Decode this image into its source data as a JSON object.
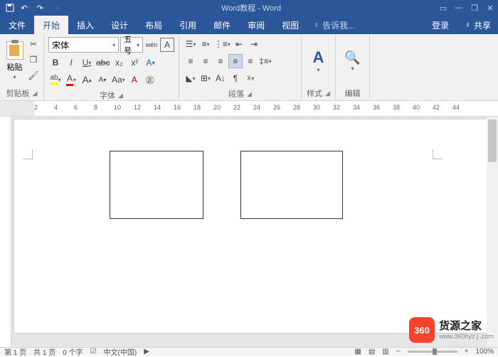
{
  "titlebar": {
    "title": "Word教程 - Word"
  },
  "tabs": {
    "file": "文件",
    "home": "开始",
    "insert": "插入",
    "design": "设计",
    "layout": "布局",
    "references": "引用",
    "mailings": "邮件",
    "review": "审阅",
    "view": "视图"
  },
  "tellme": {
    "placeholder": "告诉我..."
  },
  "account": {
    "signin": "登录",
    "share": "共享"
  },
  "ribbon": {
    "clipboard": {
      "paste": "粘贴",
      "label": "剪贴板"
    },
    "font": {
      "name": "宋体",
      "size": "五号",
      "ruby": "wén",
      "charborder": "A",
      "bold": "B",
      "italic": "I",
      "underline": "U",
      "strike": "abc",
      "sub": "x₂",
      "sup": "x²",
      "grow": "A",
      "shrink": "A",
      "case": "Aa",
      "clear": "A",
      "highlight": "ab",
      "fontcolor": "A",
      "label": "字体"
    },
    "paragraph": {
      "label": "段落"
    },
    "styles": {
      "label": "样式",
      "glyph": "A"
    },
    "edit": {
      "label": "编辑"
    }
  },
  "ruler": {
    "nums": [
      2,
      4,
      6,
      8,
      10,
      12,
      14,
      16,
      18,
      20,
      22,
      24,
      26,
      28,
      30,
      32,
      34,
      36,
      38,
      40,
      42,
      44
    ]
  },
  "status": {
    "page": "第 1 页",
    "total": "共 1 页",
    "words": "0 个字",
    "lang": "中文(中国)",
    "zoom": "100%"
  },
  "watermark": {
    "badge": "360",
    "main": "货源之家",
    "sub": "www.360hyz j .com"
  }
}
